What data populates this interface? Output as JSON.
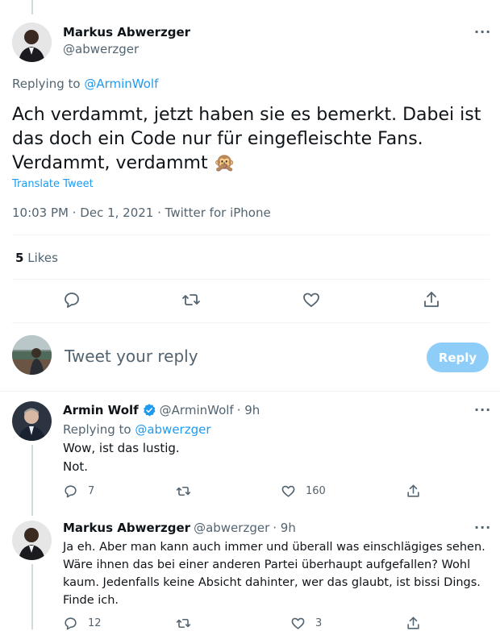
{
  "main_tweet": {
    "author_name": "Markus Abwerzger",
    "author_handle": "@abwerzger",
    "more_label": "···",
    "replying_prefix": "Replying to ",
    "replying_to": "@ArminWolf",
    "text_line1": "Ach verdammt, jetzt haben sie es bemerkt. Dabei ist",
    "text_line2": "das doch ein Code nur für eingefleischte Fans.",
    "text_line3": "Verdammt, verdammt",
    "emoji": "🙊",
    "translate_label": "Translate Tweet",
    "timestamp": "10:03 PM · Dec 1, 2021 · Twitter for iPhone",
    "likes_count": "5",
    "likes_label": "Likes"
  },
  "compose": {
    "placeholder": "Tweet your reply",
    "reply_button": "Reply"
  },
  "replies": [
    {
      "author_name": "Armin Wolf",
      "author_handle": "@ArminWolf",
      "time": "· 9h",
      "replying_prefix": "Replying to ",
      "replying_to": "@abwerzger",
      "text_lines": [
        "Wow, ist das lustig.",
        "Not."
      ],
      "reply_count": "7",
      "retweet_count": "",
      "like_count": "160"
    },
    {
      "author_name": "Markus Abwerzger",
      "author_handle": "@abwerzger",
      "time": "· 9h",
      "text_lines": [
        "Ja eh. Aber man kann auch immer und überall was einschlägiges sehen.",
        "Wäre ihnen das bei einer anderen Partei überhaupt aufgefallen? Wohl",
        "kaum. Jedenfalls keine Absicht dahinter, wer das glaubt, ist bissi Dings.",
        "Finde ich."
      ],
      "reply_count": "12",
      "retweet_count": "",
      "like_count": "3"
    }
  ],
  "colors": {
    "accent": "#1d9bf0",
    "reply_button_bg": "#8ecdf8",
    "muted": "#536471",
    "verified": "#1d9bf0"
  }
}
